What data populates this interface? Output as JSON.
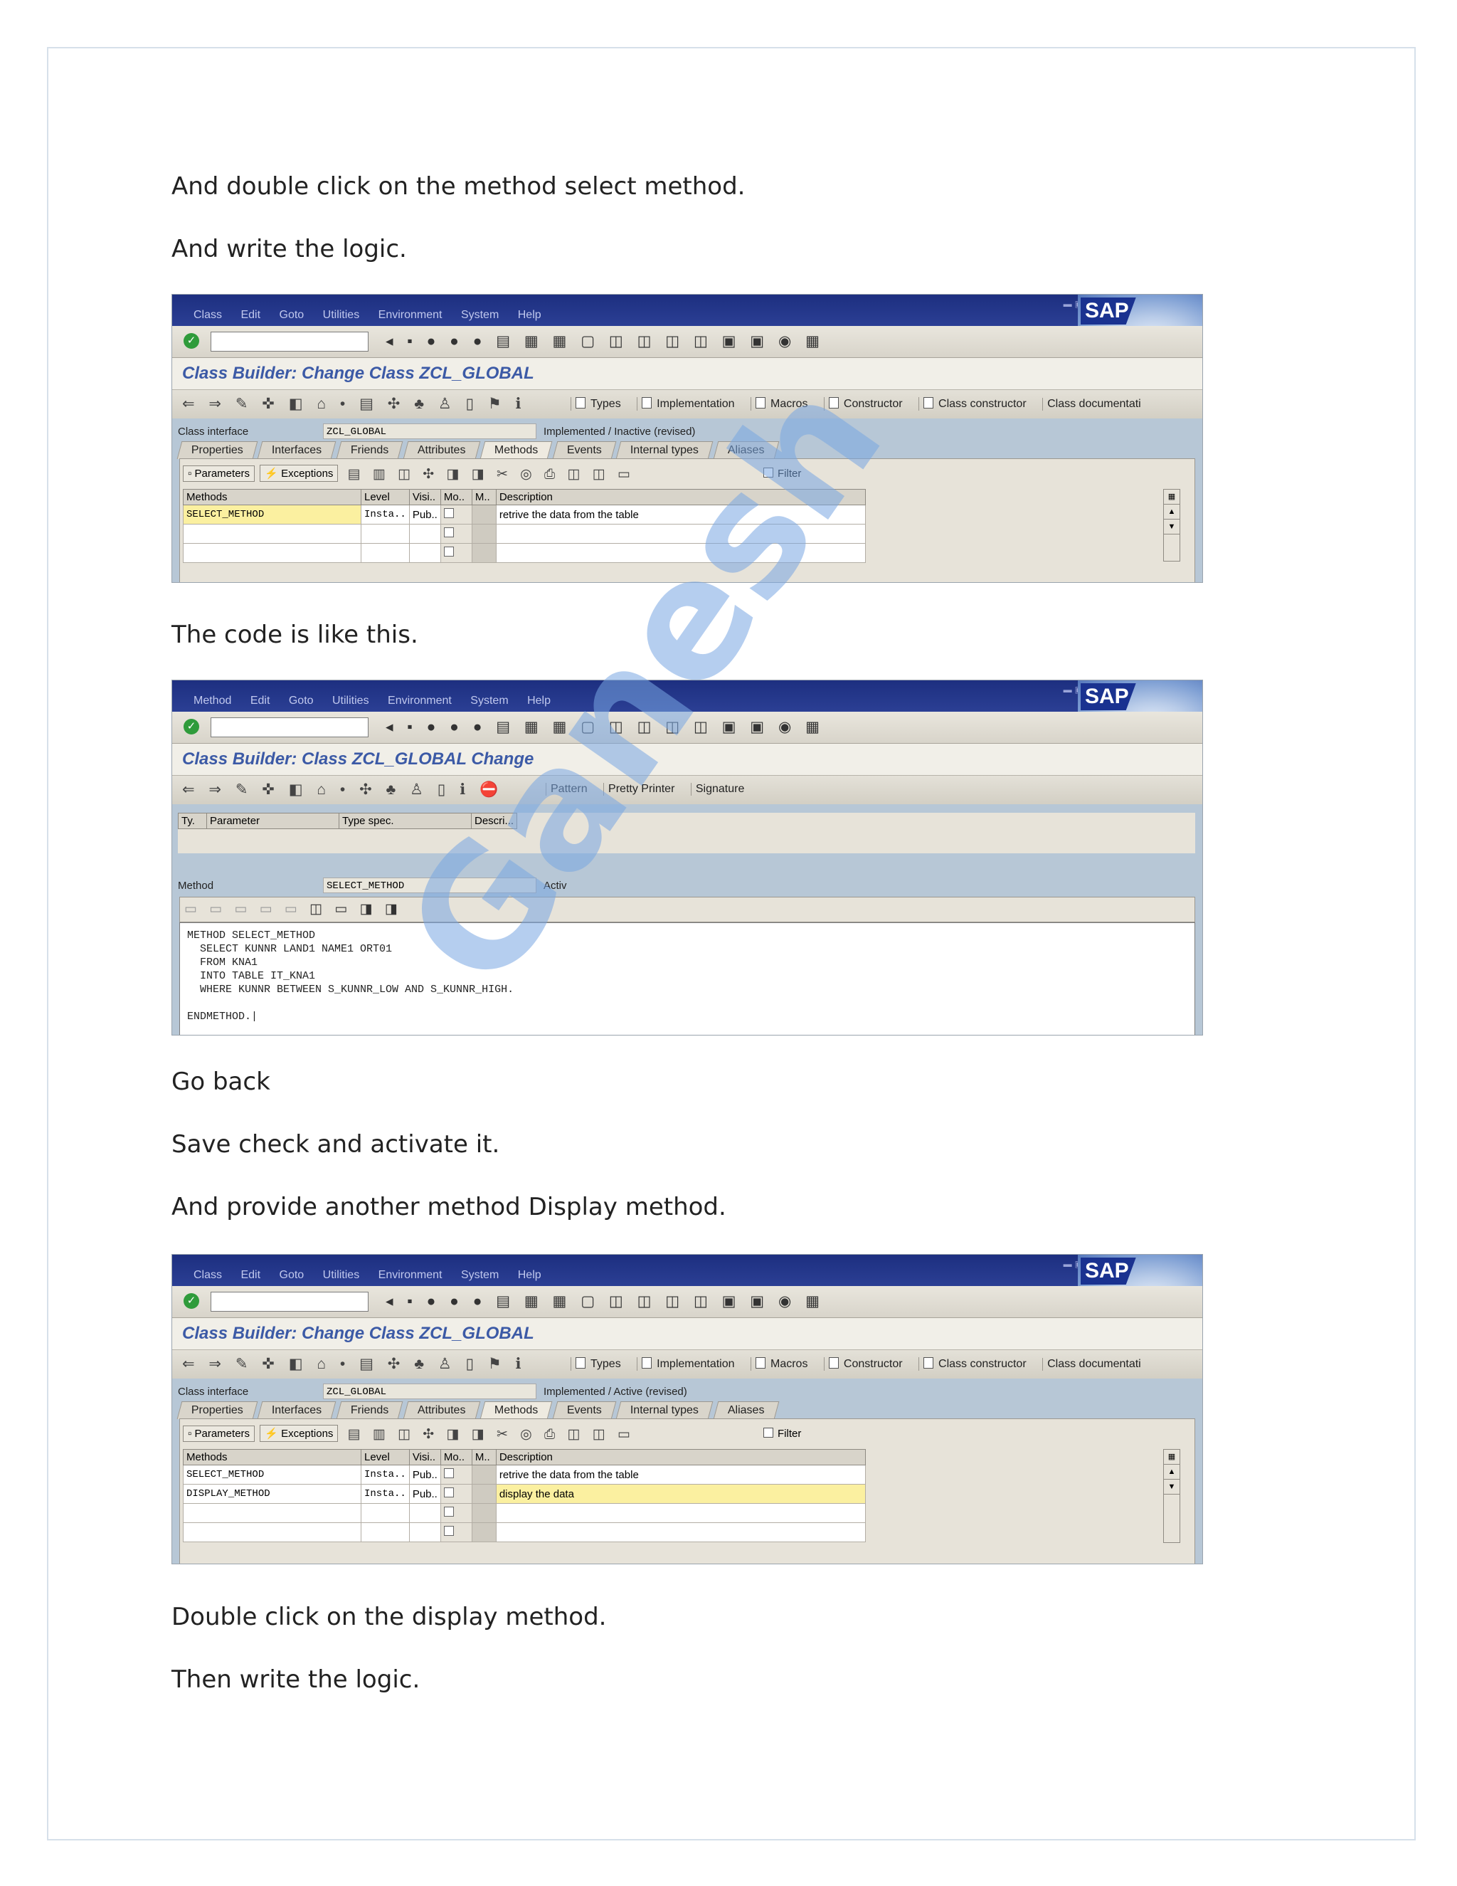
{
  "paragraphs": [
    "And double click on the method select method.",
    "And write the logic.",
    "The code is like this.",
    "Go back",
    "Save check and activate it.",
    "And provide another method Display method.",
    "Double click on the display method.",
    "Then write the logic."
  ],
  "watermark": "Ganesh",
  "sap": {
    "logo": "SAP",
    "menu": [
      "Class",
      "Edit",
      "Goto",
      "Utilities",
      "Environment",
      "System",
      "Help"
    ],
    "menu_method": [
      "Method",
      "Edit",
      "Goto",
      "Utilities",
      "Environment",
      "System",
      "Help"
    ],
    "toolbar_buttons": [
      "Types",
      "Implementation",
      "Macros",
      "Constructor",
      "Class constructor",
      "Class documentati"
    ],
    "tabs": [
      "Properties",
      "Interfaces",
      "Friends",
      "Attributes",
      "Methods",
      "Events",
      "Internal types",
      "Aliases"
    ],
    "panel_buttons": {
      "parameters": "Parameters",
      "exceptions": "Exceptions",
      "filter": "Filter"
    },
    "columns": [
      "Methods",
      "Level",
      "Visi..",
      "Mo..",
      "M..",
      "Description"
    ],
    "class_interface_label": "Class interface",
    "class_name": "ZCL_GLOBAL"
  },
  "screen1": {
    "title": "Class Builder: Change Class ZCL_GLOBAL",
    "status": "Implemented / Inactive (revised)",
    "rows": [
      {
        "method": "SELECT_METHOD",
        "level": "Insta..",
        "vis": "Pub..",
        "desc": "retrive the data from the table"
      }
    ]
  },
  "screen2": {
    "title": "Class Builder: Class ZCL_GLOBAL Change",
    "toolbar_buttons": [
      "Pattern",
      "Pretty Printer",
      "Signature"
    ],
    "param_columns": [
      "Ty.",
      "Parameter",
      "Type spec.",
      "Descri..."
    ],
    "method_label": "Method",
    "method_name": "SELECT_METHOD",
    "status": "Activ",
    "code": "METHOD SELECT_METHOD\n  SELECT KUNNR LAND1 NAME1 ORT01\n  FROM KNA1\n  INTO TABLE IT_KNA1\n  WHERE KUNNR BETWEEN S_KUNNR_LOW AND S_KUNNR_HIGH.\n\nENDMETHOD.|"
  },
  "screen3": {
    "title": "Class Builder: Change Class ZCL_GLOBAL",
    "status": "Implemented / Active (revised)",
    "rows": [
      {
        "method": "SELECT_METHOD",
        "level": "Insta..",
        "vis": "Pub..",
        "desc": "retrive the data from the table"
      },
      {
        "method": "DISPLAY_METHOD",
        "level": "Insta..",
        "vis": "Pub..",
        "desc": "display the data"
      }
    ]
  }
}
